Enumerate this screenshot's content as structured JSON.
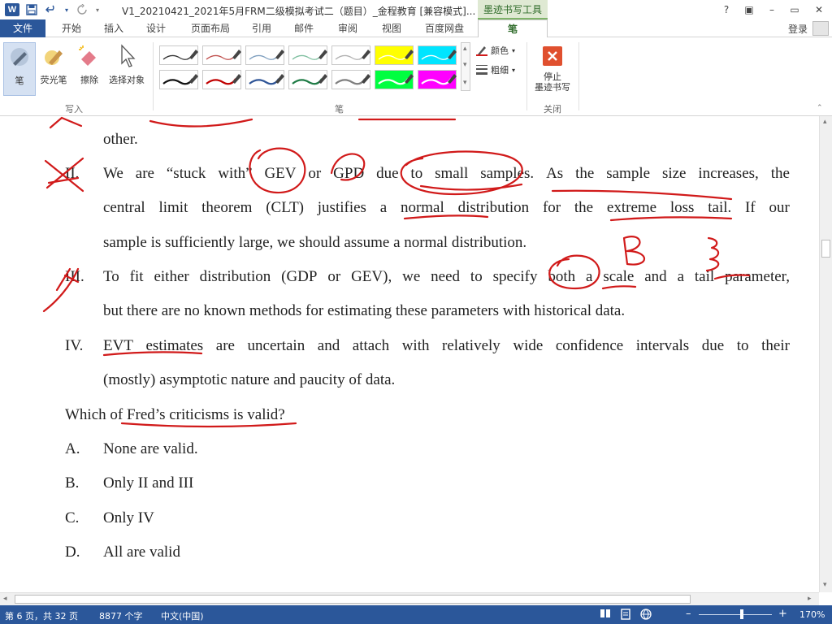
{
  "window": {
    "title": "V1_20210421_2021年5月FRM二级模拟考试二（题目）_金程教育 [兼容模式]...",
    "contextual_tab_group": "墨迹书写工具",
    "help": "?",
    "restore_ribbon": "▣",
    "minimize": "–",
    "maximize": "▭",
    "close": "✕"
  },
  "ribbon_tabs": [
    "文件",
    "开始",
    "插入",
    "设计",
    "页面布局",
    "引用",
    "邮件",
    "审阅",
    "视图",
    "百度网盘",
    "笔"
  ],
  "account": {
    "login": "登录"
  },
  "ribbon": {
    "write_tools": [
      {
        "label": "笔",
        "icon": "pen-icon"
      },
      {
        "label": "荧光笔",
        "icon": "highlighter-icon"
      },
      {
        "label": "擦除",
        "icon": "eraser-icon"
      },
      {
        "label": "选择对象",
        "icon": "select-cursor-icon"
      }
    ],
    "write_group": "写入",
    "pen_group": "笔",
    "color_label": "颜色",
    "weight_label": "粗细",
    "stop_label_1": "停止",
    "stop_label_2": "墨迹书写",
    "close_group": "关闭",
    "pen_swatches_row1": [
      "#333333",
      "#c0504d",
      "#7f9fbf",
      "#7fbfa0",
      "#b0b0b0",
      "#ffff00",
      "#00e5ff"
    ],
    "pen_swatches_row2": [
      "#111111",
      "#c00000",
      "#2f5597",
      "#1e7b45",
      "#7f7f7f",
      "#00ff40",
      "#ff00ff"
    ]
  },
  "document": {
    "line_other": "other.",
    "item2_num": "II.",
    "item2_line1": [
      "We",
      "are",
      "“stuck",
      "with”",
      "GEV",
      "or",
      "GPD",
      "due",
      "to",
      "small",
      "samples.",
      "As",
      "the",
      "sample",
      "size",
      "increases,",
      "the"
    ],
    "item2_line2": [
      "central",
      "limit",
      "theorem",
      "(CLT)",
      "justifies",
      "a",
      "normal",
      "distribution",
      "for",
      "the",
      "extreme",
      "loss",
      "tail.",
      "If",
      "our"
    ],
    "item2_line3": "sample is sufficiently large, we should assume a normal distribution.",
    "item3_num": "III.",
    "item3_line1": [
      "To",
      "fit",
      "either",
      "distribution",
      "(GDP",
      "or",
      "GEV),",
      "we",
      "need",
      "to",
      "specify",
      "both",
      "a",
      "scale",
      "and",
      "a",
      "tail",
      "parameter,"
    ],
    "item3_line2": "but there are no known methods for estimating these parameters with historical data.",
    "item4_num": "IV.",
    "item4_line1": [
      "EVT",
      "estimates",
      "are",
      "uncertain",
      "and",
      "attach",
      "with",
      "relatively",
      "wide",
      "confidence",
      "intervals",
      "due",
      "to",
      "their"
    ],
    "item4_line2": "(mostly) asymptotic nature and paucity of data.",
    "question": "Which of Fred’s criticisms is valid?",
    "options": [
      {
        "letter": "A.",
        "text": "None are valid."
      },
      {
        "letter": "B.",
        "text": "Only II and III"
      },
      {
        "letter": "C.",
        "text": "Only IV"
      },
      {
        "letter": "D.",
        "text": "All are valid"
      }
    ]
  },
  "ink_color": "#d11a1a",
  "status": {
    "page": "第 6 页，共 32 页",
    "words": "8877 个字",
    "language": "中文(中国)",
    "zoom": "170%",
    "zoom_out": "–",
    "zoom_in": "+"
  }
}
